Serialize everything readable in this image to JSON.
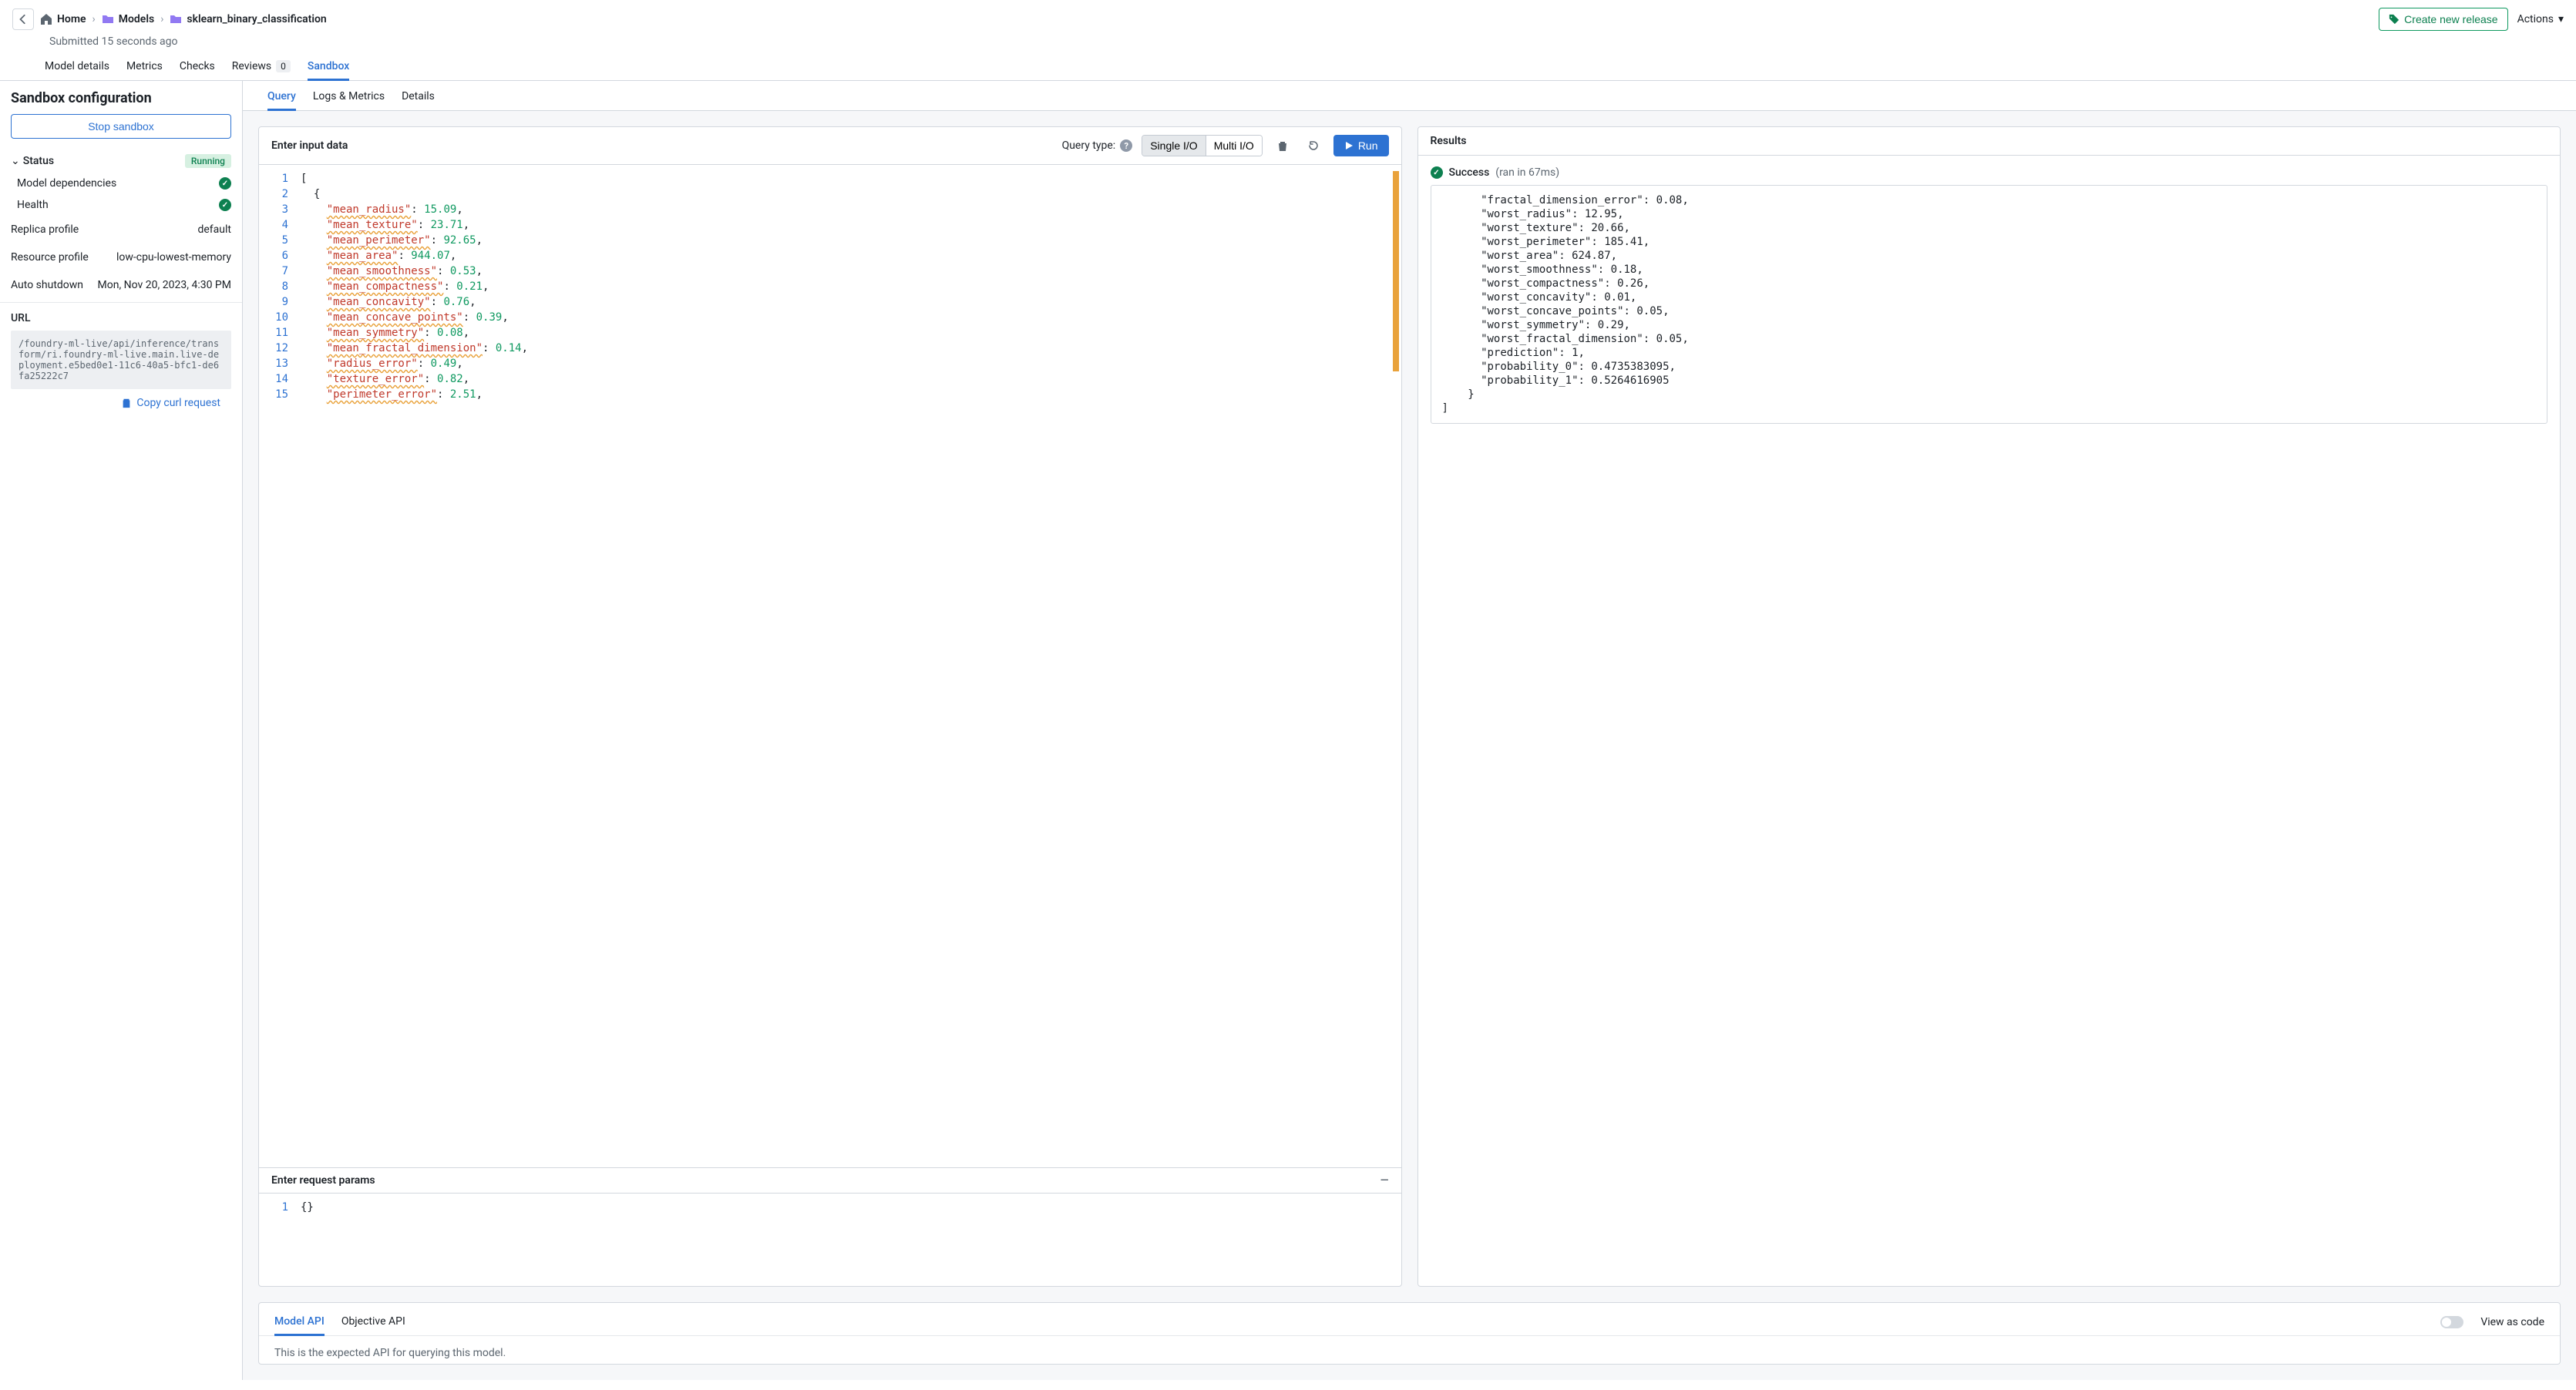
{
  "breadcrumb": {
    "home": "Home",
    "models": "Models",
    "current": "sklearn_binary_classification"
  },
  "submitted": "Submitted 15 seconds ago",
  "header": {
    "create_release": "Create new release",
    "actions": "Actions"
  },
  "tabs_primary": {
    "model_details": "Model details",
    "metrics": "Metrics",
    "checks": "Checks",
    "reviews": "Reviews",
    "reviews_count": "0",
    "sandbox": "Sandbox"
  },
  "sidebar": {
    "title": "Sandbox configuration",
    "stop": "Stop sandbox",
    "status_label": "Status",
    "status_badge": "Running",
    "model_deps": "Model dependencies",
    "health": "Health",
    "replica_profile_k": "Replica profile",
    "replica_profile_v": "default",
    "resource_profile_k": "Resource profile",
    "resource_profile_v": "low-cpu-lowest-memory",
    "auto_shutdown_k": "Auto shutdown",
    "auto_shutdown_v": "Mon, Nov 20, 2023, 4:30 PM",
    "url_label": "URL",
    "url_value": "/foundry-ml-live/api/inference/transform/ri.foundry-ml-live.main.live-deployment.e5bed0e1-11c6-40a5-bfc1-de6fa25222c7",
    "copy_curl": "Copy curl request"
  },
  "inner_tabs": {
    "query": "Query",
    "logs": "Logs & Metrics",
    "details": "Details"
  },
  "input_panel": {
    "title": "Enter input data",
    "query_type": "Query type:",
    "single": "Single I/O",
    "multi": "Multi I/O",
    "run": "Run",
    "params_title": "Enter request params",
    "params_body": "{}",
    "code_lines": [
      {
        "n": 1,
        "t": "["
      },
      {
        "n": 2,
        "t": "  {"
      },
      {
        "n": 3,
        "k": "mean_radius",
        "v": "15.09"
      },
      {
        "n": 4,
        "k": "mean_texture",
        "v": "23.71"
      },
      {
        "n": 5,
        "k": "mean_perimeter",
        "v": "92.65"
      },
      {
        "n": 6,
        "k": "mean_area",
        "v": "944.07"
      },
      {
        "n": 7,
        "k": "mean_smoothness",
        "v": "0.53"
      },
      {
        "n": 8,
        "k": "mean_compactness",
        "v": "0.21"
      },
      {
        "n": 9,
        "k": "mean_concavity",
        "v": "0.76"
      },
      {
        "n": 10,
        "k": "mean_concave_points",
        "v": "0.39"
      },
      {
        "n": 11,
        "k": "mean_symmetry",
        "v": "0.08"
      },
      {
        "n": 12,
        "k": "mean_fractal_dimension",
        "v": "0.14"
      },
      {
        "n": 13,
        "k": "radius_error",
        "v": "0.49"
      },
      {
        "n": 14,
        "k": "texture_error",
        "v": "0.82"
      },
      {
        "n": 15,
        "k": "perimeter_error",
        "v": "2.51"
      }
    ]
  },
  "results": {
    "title": "Results",
    "success": "Success",
    "time": "(ran in 67ms)",
    "lines": [
      "      \"fractal_dimension_error\": 0.08,",
      "      \"worst_radius\": 12.95,",
      "      \"worst_texture\": 20.66,",
      "      \"worst_perimeter\": 185.41,",
      "      \"worst_area\": 624.87,",
      "      \"worst_smoothness\": 0.18,",
      "      \"worst_compactness\": 0.26,",
      "      \"worst_concavity\": 0.01,",
      "      \"worst_concave_points\": 0.05,",
      "      \"worst_symmetry\": 0.29,",
      "      \"worst_fractal_dimension\": 0.05,",
      "      \"prediction\": 1,",
      "      \"probability_0\": 0.4735383095,",
      "      \"probability_1\": 0.5264616905",
      "    }",
      "]"
    ]
  },
  "bottom": {
    "model_api": "Model API",
    "objective_api": "Objective API",
    "view_as_code": "View as code",
    "desc": "This is the expected API for querying this model."
  }
}
